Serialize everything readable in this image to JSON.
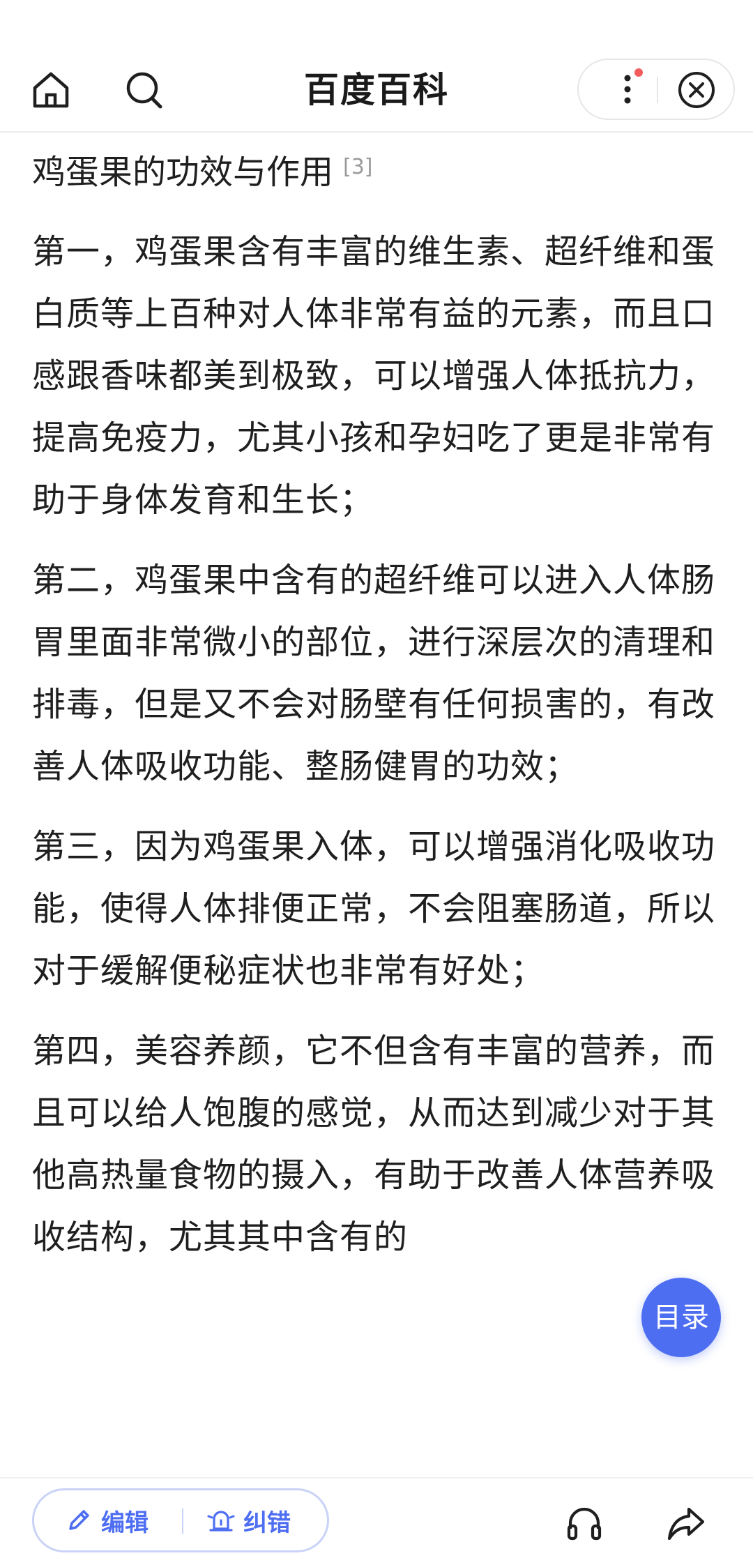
{
  "header": {
    "title": "百度百科"
  },
  "article": {
    "section_title": "鸡蛋果的功效与作用",
    "ref_mark": "[3]",
    "paragraphs": [
      "第一，鸡蛋果含有丰富的维生素、超纤维和蛋白质等上百种对人体非常有益的元素，而且口感跟香味都美到极致，可以增强人体抵抗力，提高免疫力，尤其小孩和孕妇吃了更是非常有助于身体发育和生长；",
      "第二，鸡蛋果中含有的超纤维可以进入人体肠胃里面非常微小的部位，进行深层次的清理和排毒，但是又不会对肠壁有任何损害的，有改善人体吸收功能、整肠健胃的功效；",
      "第三，因为鸡蛋果入体，可以增强消化吸收功能，使得人体排便正常，不会阻塞肠道，所以对于缓解便秘症状也非常有好处；",
      "第四，美容养颜，它不但含有丰富的营养，而且可以给人饱腹的感觉，从而达到减少对于其他高热量食物的摄入，有助于改善人体营养吸收结构，尤其其中含有的"
    ]
  },
  "toc_button": "目录",
  "bottom_bar": {
    "edit_label": "编辑",
    "fix_label": "纠错"
  },
  "colors": {
    "accent": "#4e6ef2",
    "notification_dot": "#f25c5c",
    "text": "#1f1f1f"
  },
  "icons": [
    "home-icon",
    "search-icon",
    "more-icon",
    "close-icon",
    "pencil-icon",
    "feedback-icon",
    "headphones-icon",
    "share-icon"
  ]
}
